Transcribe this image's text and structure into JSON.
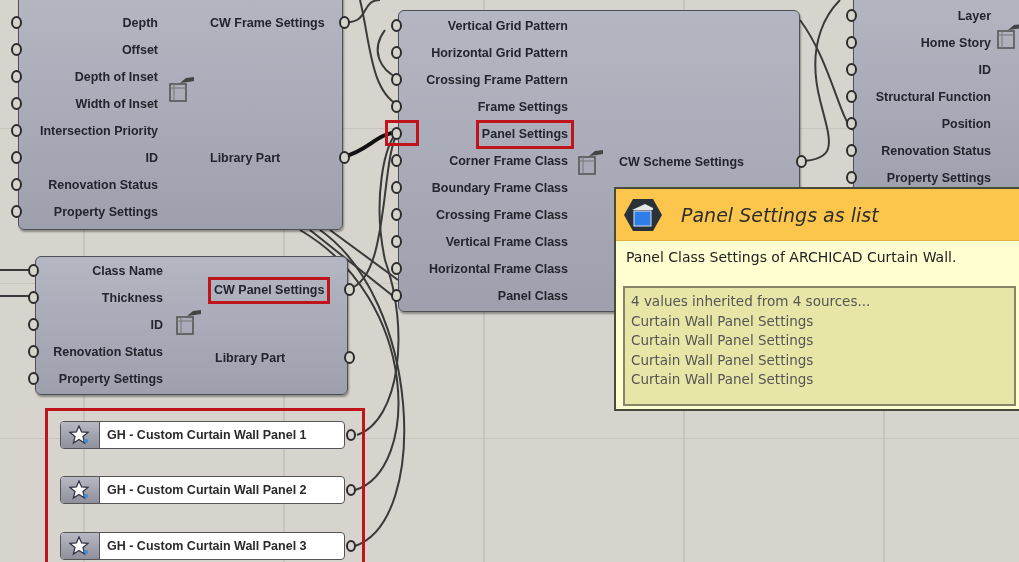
{
  "nodes": [
    {
      "inputs": [
        {
          "label": "Depth",
          "highlighted": false,
          "port_highlighted": false
        },
        {
          "label": "Offset",
          "highlighted": false,
          "port_highlighted": false
        },
        {
          "label": "Depth of Inset",
          "highlighted": false,
          "port_highlighted": false
        },
        {
          "label": "Width of Inset",
          "highlighted": false,
          "port_highlighted": false
        },
        {
          "label": "Intersection Priority",
          "highlighted": false,
          "port_highlighted": false
        },
        {
          "label": "ID",
          "highlighted": false,
          "port_highlighted": false
        },
        {
          "label": "Renovation Status",
          "highlighted": false,
          "port_highlighted": false
        },
        {
          "label": "Property Settings",
          "highlighted": false,
          "port_highlighted": false
        }
      ],
      "outputs": [
        {
          "label": "CW Frame Settings",
          "highlighted": false
        },
        {
          "label": "Library Part",
          "highlighted": false
        }
      ]
    },
    {
      "inputs": [
        {
          "label": "Vertical Grid Pattern",
          "highlighted": false,
          "port_highlighted": false
        },
        {
          "label": "Horizontal Grid Pattern",
          "highlighted": false,
          "port_highlighted": false
        },
        {
          "label": "Crossing Frame Pattern",
          "highlighted": false,
          "port_highlighted": false
        },
        {
          "label": "Frame Settings",
          "highlighted": false,
          "port_highlighted": false
        },
        {
          "label": "Panel Settings",
          "highlighted": true,
          "port_highlighted": true
        },
        {
          "label": "Corner Frame Class",
          "highlighted": false,
          "port_highlighted": false
        },
        {
          "label": "Boundary Frame Class",
          "highlighted": false,
          "port_highlighted": false
        },
        {
          "label": "Crossing Frame Class",
          "highlighted": false,
          "port_highlighted": false
        },
        {
          "label": "Vertical Frame Class",
          "highlighted": false,
          "port_highlighted": false
        },
        {
          "label": "Horizontal Frame Class",
          "highlighted": false,
          "port_highlighted": false
        },
        {
          "label": "Panel Class",
          "highlighted": false,
          "port_highlighted": false
        }
      ],
      "outputs": [
        {
          "label": "CW Scheme Settings",
          "highlighted": false
        }
      ]
    },
    {
      "inputs": [
        {
          "label": "Layer",
          "highlighted": false,
          "port_highlighted": false
        },
        {
          "label": "Home Story",
          "highlighted": false,
          "port_highlighted": false
        },
        {
          "label": "ID",
          "highlighted": false,
          "port_highlighted": false
        },
        {
          "label": "Structural Function",
          "highlighted": false,
          "port_highlighted": false
        },
        {
          "label": "Position",
          "highlighted": false,
          "port_highlighted": false
        },
        {
          "label": "Renovation Status",
          "highlighted": false,
          "port_highlighted": false
        },
        {
          "label": "Property Settings",
          "highlighted": false,
          "port_highlighted": false
        }
      ]
    },
    {
      "inputs": [
        {
          "label": "Class Name",
          "highlighted": false,
          "port_highlighted": false
        },
        {
          "label": "Thickness",
          "highlighted": false,
          "port_highlighted": false
        },
        {
          "label": "ID",
          "highlighted": false,
          "port_highlighted": false
        },
        {
          "label": "Renovation Status",
          "highlighted": false,
          "port_highlighted": false
        },
        {
          "label": "Property Settings",
          "highlighted": false,
          "port_highlighted": false
        }
      ],
      "outputs": [
        {
          "label": "CW Panel Settings",
          "highlighted": true
        },
        {
          "label": "Library Part",
          "highlighted": false
        }
      ]
    }
  ],
  "value_lists": {
    "highlighted": true,
    "items": [
      {
        "label": "GH - Custom Curtain Wall Panel 1"
      },
      {
        "label": "GH - Custom Curtain Wall Panel 2"
      },
      {
        "label": "GH - Custom Curtain Wall Panel 3"
      }
    ]
  },
  "tooltip": {
    "title": "Panel Settings as list",
    "description": "Panel Class Settings of ARCHICAD Curtain Wall.",
    "values": [
      "4 values inherited from 4 sources...",
      "Curtain Wall Panel Settings",
      "Curtain Wall Panel Settings",
      "Curtain Wall Panel Settings",
      "Curtain Wall Panel Settings"
    ]
  }
}
